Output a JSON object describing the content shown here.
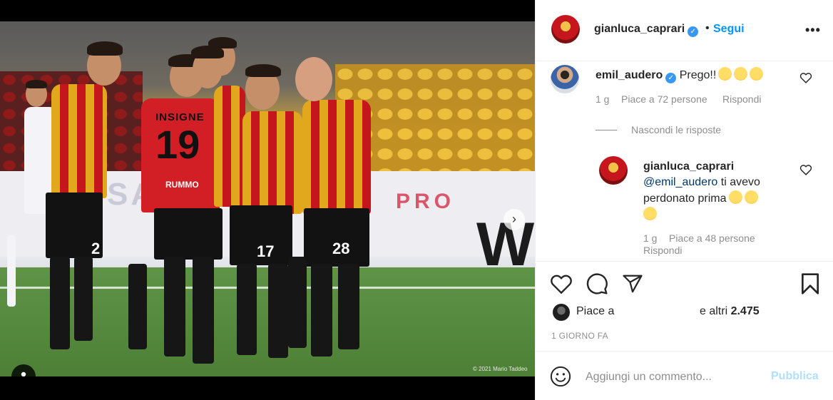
{
  "media": {
    "copyright": "© 2021 Mario Taddeo",
    "jersey_names": [
      "INSIGNE",
      "RUMMO"
    ],
    "jersey_numbers": [
      "19",
      "17",
      "28",
      "2"
    ],
    "board_text": "SA",
    "board_letter": "W",
    "board_red": "PRO",
    "carousel_total": 2,
    "carousel_active": 1
  },
  "header": {
    "username": "gianluca_caprari",
    "separator": "•",
    "follow_label": "Segui",
    "more_label": "•••"
  },
  "comments": [
    {
      "username": "emil_audero",
      "text": "Prego!!",
      "emojis": [
        "grinning-sweat-emoji",
        "face-with-open-mouth-emoji",
        "kissing-wink-emoji"
      ],
      "time": "1 g",
      "likes": "Piace a 72 persone",
      "reply_label": "Rispondi",
      "hide_replies_label": "Nascondi le risposte",
      "replies": [
        {
          "username": "gianluca_caprari",
          "mention": "@emil_audero",
          "text_line1": " ti avevo",
          "text_line2": "perdonato prima",
          "emojis": [
            "smile-emoji",
            "rofl-emoji",
            "kissing-wink-emoji"
          ],
          "time": "1 g",
          "likes": "Piace a 48 persone",
          "reply_label": "Rispondi"
        }
      ]
    }
  ],
  "likes": {
    "prefix": "Piace a",
    "suffix": "e altri",
    "count": "2.475"
  },
  "date": "1 GIORNO FA",
  "add_comment": {
    "placeholder": "Aggiungi un commento...",
    "publish_label": "Pubblica"
  },
  "colors": {
    "accent": "#0095f6",
    "verified": "#3897f0",
    "muted": "#8e8e8e",
    "publish_disabled": "#b2dffc"
  }
}
